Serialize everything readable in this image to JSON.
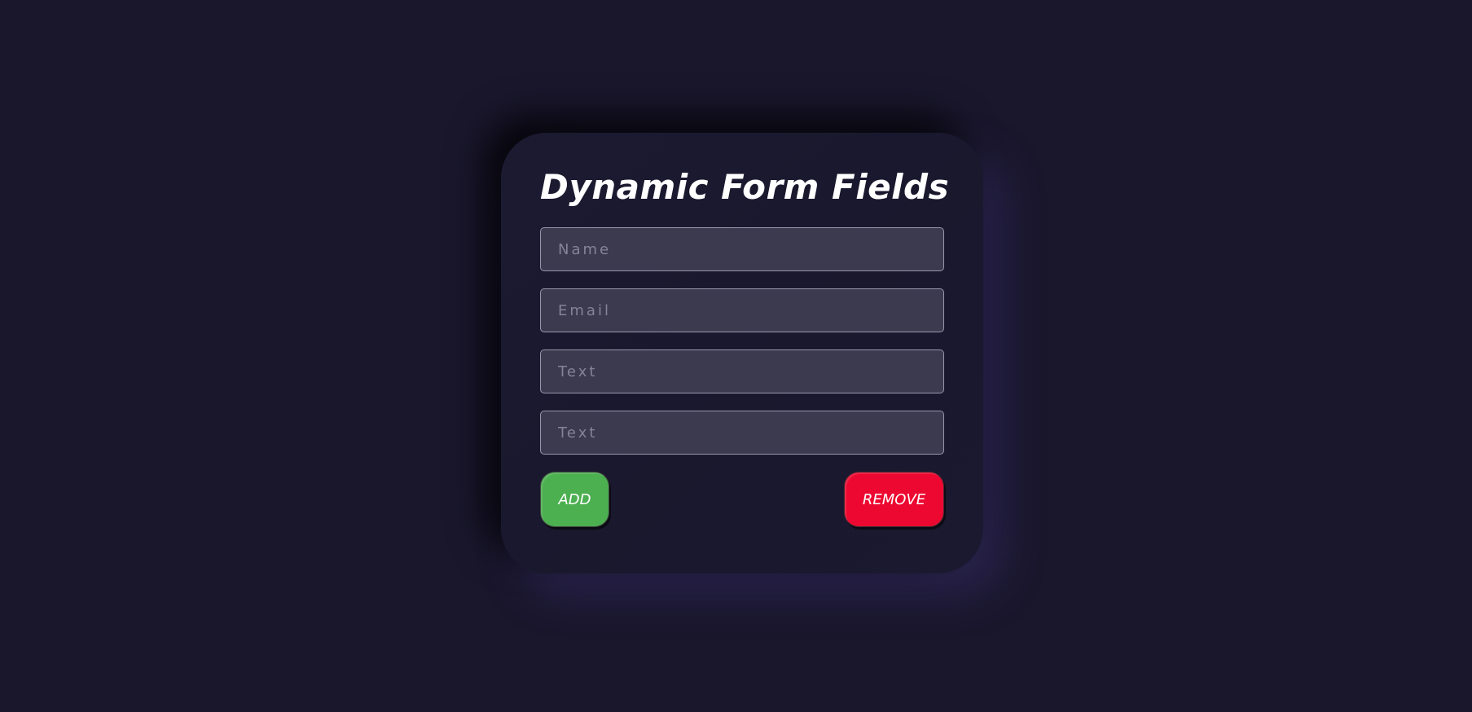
{
  "form": {
    "title": "Dynamic Form Fields",
    "fields": [
      {
        "placeholder": "Name",
        "value": ""
      },
      {
        "placeholder": "Email",
        "value": ""
      },
      {
        "placeholder": "Text",
        "value": ""
      },
      {
        "placeholder": "Text",
        "value": ""
      }
    ],
    "add_label": "ADD",
    "remove_label": "REMOVE"
  },
  "colors": {
    "background": "#1a172d",
    "card": "#1c1a31",
    "field_bg": "#3c3a4f",
    "add_button": "#4caf50",
    "remove_button": "#ec0830"
  }
}
